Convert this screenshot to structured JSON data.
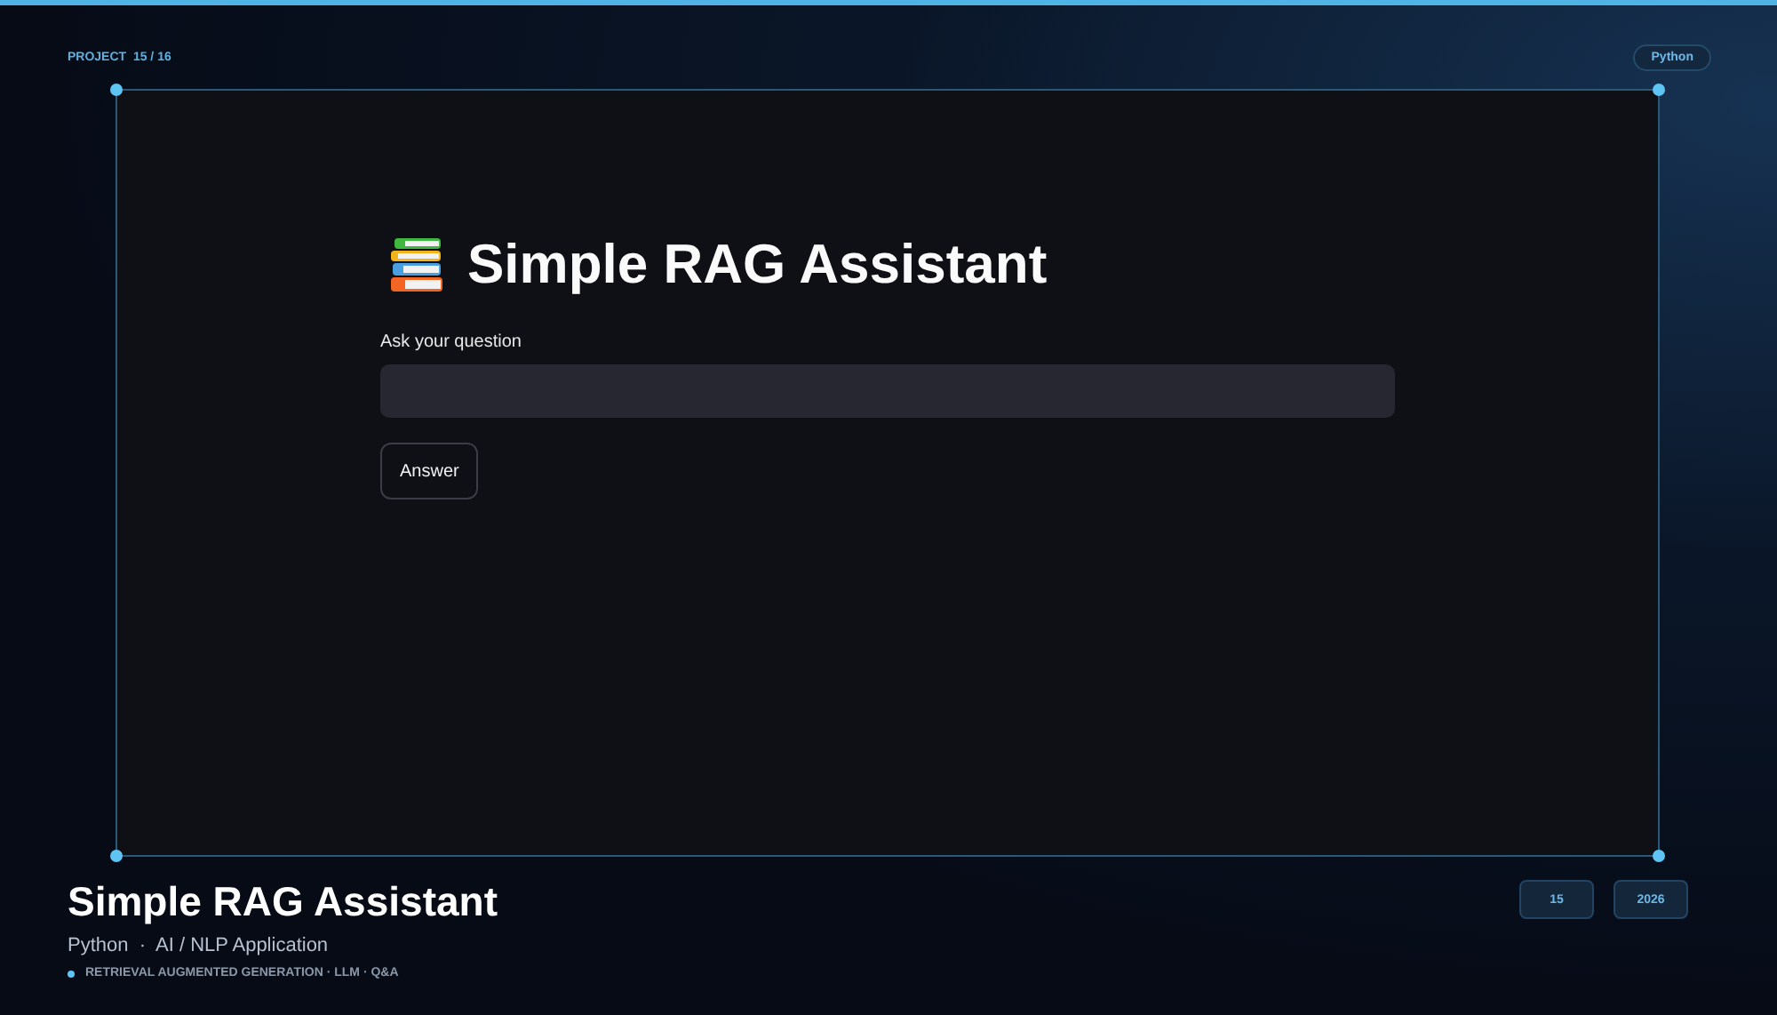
{
  "header": {
    "project_counter": "PROJECT  15 / 16",
    "language_badge": "Python"
  },
  "screenshot": {
    "app_title": "Simple RAG Assistant",
    "input_label": "Ask your question",
    "button": "Answer"
  },
  "footer": {
    "title": "Simple RAG Assistant",
    "subtitle": "Python  ·  AI / NLP Application",
    "tags": "RETRIEVAL AUGMENTED GENERATION · LLM · Q&A",
    "badges": [
      "15",
      "2026"
    ]
  }
}
